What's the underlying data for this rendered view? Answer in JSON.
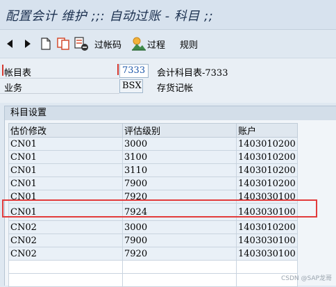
{
  "window": {
    "title": "配置会计 维护 ;;: 自动过账 - 科目 ;;"
  },
  "toolbar": {
    "prev_icon": "triangle-left-icon",
    "next_icon": "triangle-right-icon",
    "new_icon": "new-document-icon",
    "copy_icon": "copy-icon",
    "delete_icon": "delete-icon",
    "posting_key_label": "过帐码",
    "procedures_label": "过程",
    "rules_label": "规则"
  },
  "form": {
    "chart_label": "帐目表",
    "chart_value": "7333",
    "chart_desc": "会计科目表-7333",
    "transaction_label": "业务",
    "transaction_value": "BSX",
    "transaction_desc": "存货记帐"
  },
  "group": {
    "title": "科目设置",
    "columns": [
      "估价修改",
      "评估级别",
      "账户"
    ],
    "rows": [
      {
        "mod": "CN01",
        "class": "3000",
        "account": "1403010200"
      },
      {
        "mod": "CN01",
        "class": "3100",
        "account": "1403010200"
      },
      {
        "mod": "CN01",
        "class": "3110",
        "account": "1403010200"
      },
      {
        "mod": "CN01",
        "class": "7900",
        "account": "1403010200"
      },
      {
        "mod": "CN01",
        "class": "7920",
        "account": "1403030100"
      },
      {
        "mod": "CN01",
        "class": "7924",
        "account": "1403030100"
      },
      {
        "mod": "CN02",
        "class": "3000",
        "account": "1403010200"
      },
      {
        "mod": "CN02",
        "class": "7900",
        "account": "1403030100"
      },
      {
        "mod": "CN02",
        "class": "7920",
        "account": "1403030100"
      }
    ]
  },
  "watermark": "CSDN @SAP龙哥",
  "colors": {
    "highlight": "#e23b3b",
    "link": "#1a55a8"
  }
}
